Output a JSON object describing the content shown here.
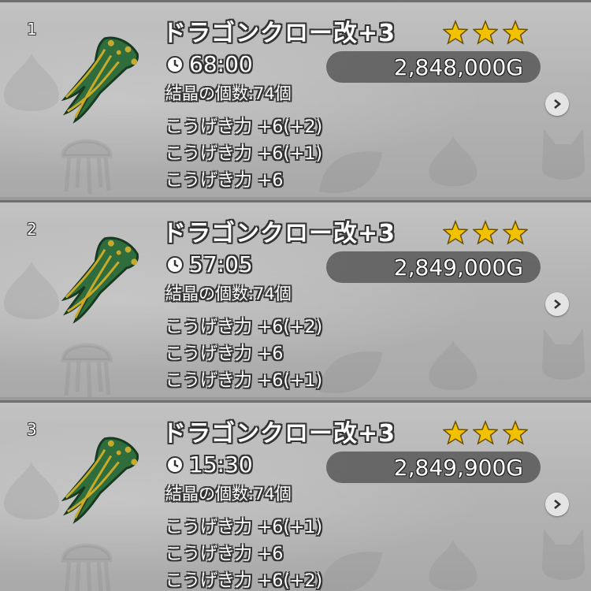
{
  "colors": {
    "star": "#f2c200",
    "price_pill": "#464646",
    "panel": "#b8b8b8",
    "claw_green": "#2f6e3c",
    "claw_gold": "#c8a92a"
  },
  "icons": {
    "item": "dragon-claw-icon",
    "timer": "clock-icon",
    "rarity": "star-icon",
    "detail": "chevron-right-icon"
  },
  "listings": [
    {
      "rank": "1",
      "name": "ドラゴンクロー改+3",
      "stars": 3,
      "time_remaining": "68:00",
      "price": "2,848,000G",
      "crystals": "結晶の個数:74個",
      "effects": [
        "こうげき力 +6(+2)",
        "こうげき力 +6(+1)",
        "こうげき力 +6"
      ]
    },
    {
      "rank": "2",
      "name": "ドラゴンクロー改+3",
      "stars": 3,
      "time_remaining": "57:05",
      "price": "2,849,000G",
      "crystals": "結晶の個数:74個",
      "effects": [
        "こうげき力 +6(+2)",
        "こうげき力 +6",
        "こうげき力 +6(+1)"
      ]
    },
    {
      "rank": "3",
      "name": "ドラゴンクロー改+3",
      "stars": 3,
      "time_remaining": "15:30",
      "price": "2,849,900G",
      "crystals": "結晶の個数:74個",
      "effects": [
        "こうげき力 +6(+1)",
        "こうげき力 +6",
        "こうげき力 +6(+2)"
      ]
    }
  ]
}
